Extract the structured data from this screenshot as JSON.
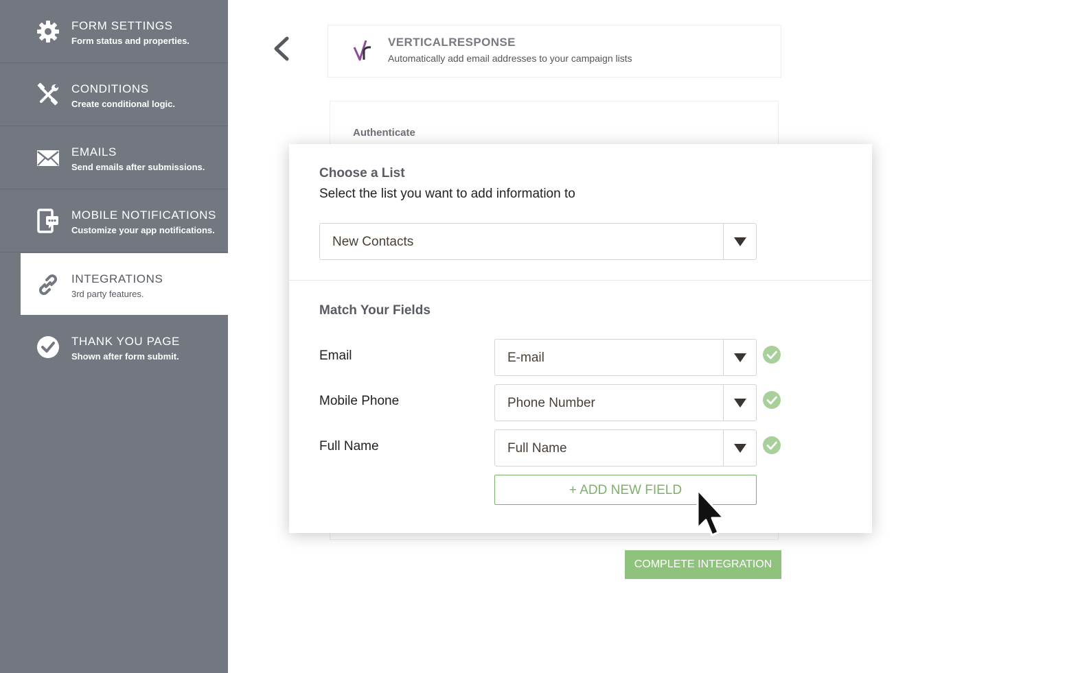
{
  "sidebar": {
    "items": [
      {
        "title": "FORM SETTINGS",
        "subtitle": "Form status and properties.",
        "icon": "gear-icon"
      },
      {
        "title": "CONDITIONS",
        "subtitle": "Create conditional logic.",
        "icon": "conditions-tools-icon"
      },
      {
        "title": "EMAILS",
        "subtitle": "Send emails after submissions.",
        "icon": "envelope-icon"
      },
      {
        "title": "MOBILE NOTIFICATIONS",
        "subtitle": "Customize your app notifications.",
        "icon": "mobile-notification-icon"
      },
      {
        "title": "INTEGRATIONS",
        "subtitle": "3rd party features.",
        "icon": "link-icon",
        "active": true
      },
      {
        "title": "THANK YOU PAGE",
        "subtitle": "Shown after form submit.",
        "icon": "check-circle-icon"
      }
    ]
  },
  "integration": {
    "name": "VERTICALRESPONSE",
    "description": "Automatically add email addresses to your campaign lists"
  },
  "auth": {
    "label": "Authenticate"
  },
  "modal": {
    "choose_title": "Choose a List",
    "choose_subtitle": "Select the list you want to add information to",
    "list_value": "New Contacts",
    "match_title": "Match Your Fields",
    "fields": [
      {
        "label": "Email",
        "value": "E-mail",
        "matched": true
      },
      {
        "label": "Mobile Phone",
        "value": "Phone Number",
        "matched": true
      },
      {
        "label": "Full Name",
        "value": "Full Name",
        "matched": true
      }
    ],
    "add_field_label": "+ ADD NEW FIELD"
  },
  "complete_label": "COMPLETE INTEGRATION",
  "colors": {
    "sidebar_bg": "#727780",
    "accent_green": "#7fb069",
    "button_green": "#8fc27d",
    "logo_purple": "#8e4a9c"
  }
}
